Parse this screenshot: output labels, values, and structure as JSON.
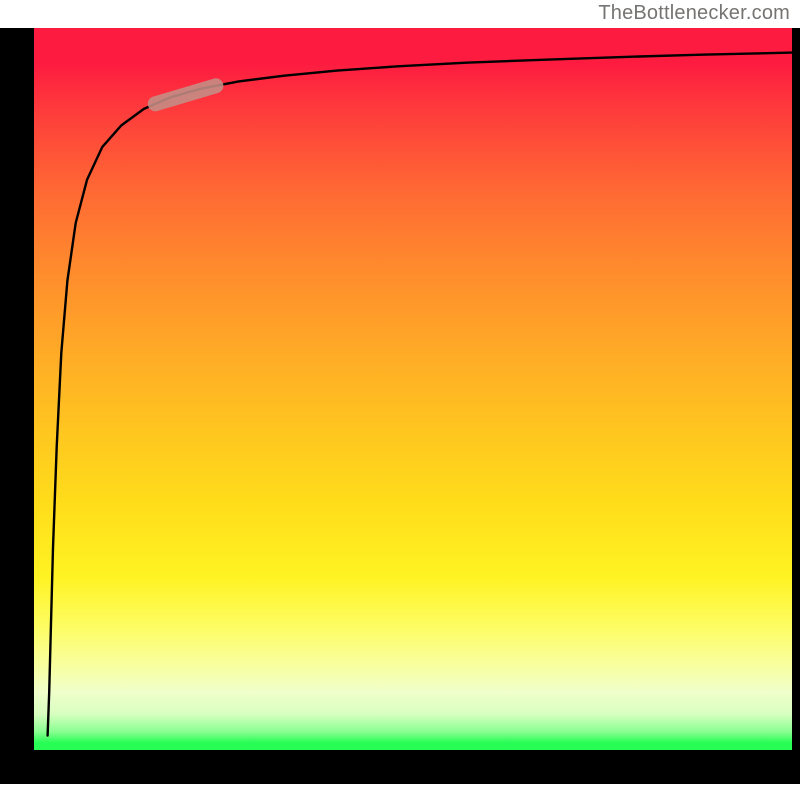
{
  "attribution": "TheBottlenecker.com",
  "chart_data": {
    "type": "line",
    "title": "",
    "xlabel": "",
    "ylabel": "",
    "xlim": [
      0,
      100
    ],
    "ylim": [
      0,
      100
    ],
    "series": [
      {
        "name": "bottleneck-curve",
        "x": [
          1.8,
          2.0,
          2.2,
          2.5,
          3.0,
          3.6,
          4.4,
          5.5,
          7.0,
          9.0,
          11.5,
          14.5,
          18,
          22,
          27,
          33,
          40,
          48,
          57,
          67,
          78,
          88,
          96,
          100
        ],
        "y": [
          2,
          8,
          16,
          28,
          42,
          55,
          65,
          73,
          79,
          83.5,
          86.5,
          88.8,
          90.4,
          91.6,
          92.6,
          93.4,
          94.1,
          94.7,
          95.2,
          95.6,
          96.0,
          96.3,
          96.5,
          96.6
        ]
      },
      {
        "name": "highlight-segment",
        "x": [
          16,
          24
        ],
        "y": [
          89.5,
          92.0
        ]
      }
    ],
    "gradient_stops": [
      {
        "pct": 0,
        "color": "#fd1c40"
      },
      {
        "pct": 22,
        "color": "#ff8a2d"
      },
      {
        "pct": 55,
        "color": "#ffdd1a"
      },
      {
        "pct": 88,
        "color": "#f0ffcb"
      },
      {
        "pct": 100,
        "color": "#27fd55"
      }
    ]
  }
}
